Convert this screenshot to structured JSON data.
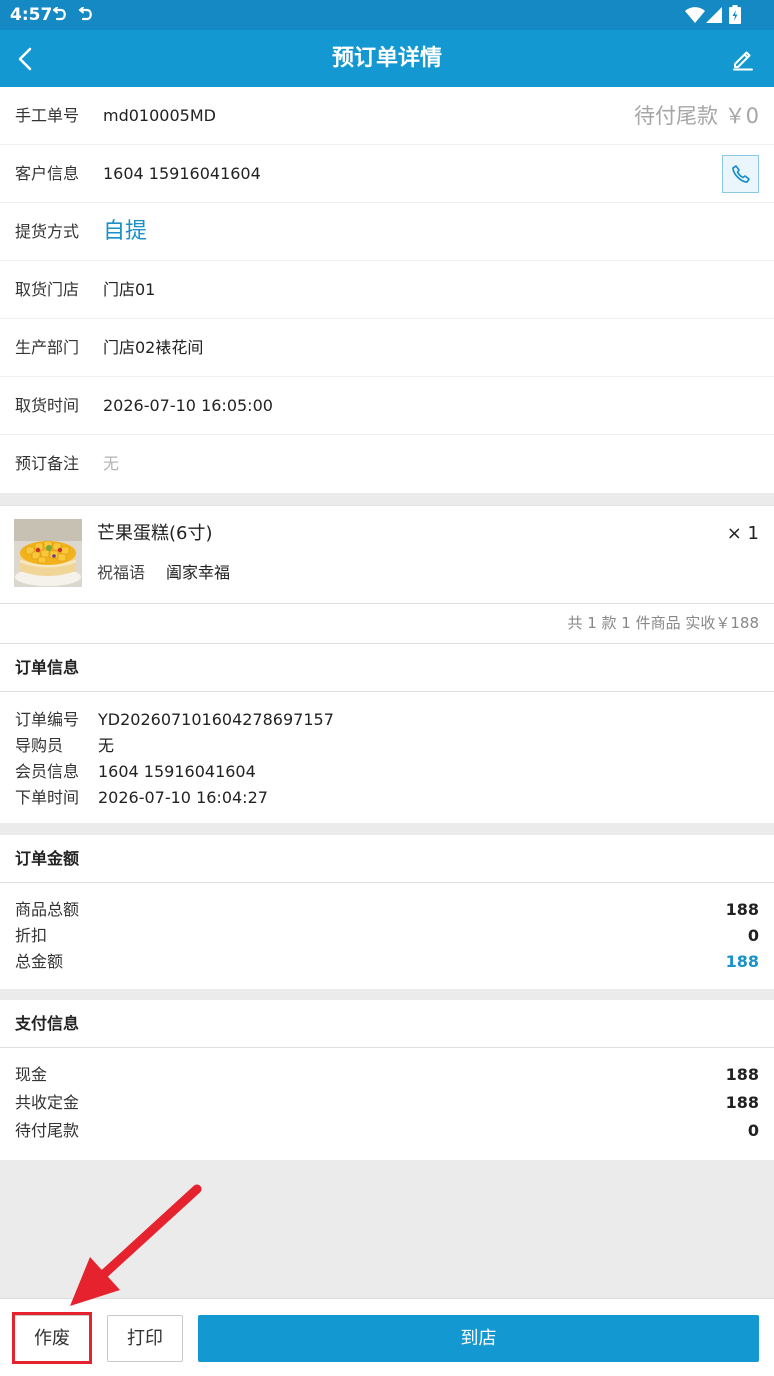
{
  "status_bar": {
    "time": "4:57",
    "icons": [
      "notification-icon",
      "notification-icon",
      "wifi-icon",
      "signal-icon",
      "battery-icon"
    ]
  },
  "header": {
    "title": "预订单详情",
    "left_icon": "back-arrow-icon",
    "right_icon": "edit-icon"
  },
  "details": [
    {
      "label": "手工单号",
      "value": "md010005MD",
      "extra": "待付尾款 ￥0"
    },
    {
      "label": "客户信息",
      "value": "1604 15916041604",
      "action_icon": "phone-icon"
    },
    {
      "label": "提货方式",
      "value": "自提"
    },
    {
      "label": "取货门店",
      "value": "门店01"
    },
    {
      "label": "生产部门",
      "value": "门店02裱花间"
    },
    {
      "label": "取货时间",
      "value": "2026-07-10 16:05:00"
    },
    {
      "label": "预订备注",
      "value": "无"
    }
  ],
  "product": {
    "name": "芒果蛋糕(6寸)",
    "blessing_label": "祝福语",
    "blessing": "阖家幸福",
    "quantity": "× 1"
  },
  "summary": "共 1 款 1 件商品 实收￥188",
  "order_info": {
    "title": "订单信息",
    "rows": [
      {
        "label": "订单编号",
        "value": "YD202607101604278697157"
      },
      {
        "label": "导购员",
        "value": "无"
      },
      {
        "label": "会员信息",
        "value": "1604 15916041604"
      },
      {
        "label": "下单时间",
        "value": "2026-07-10 16:04:27"
      }
    ]
  },
  "order_amount": {
    "title": "订单金额",
    "rows": [
      {
        "label": "商品总额",
        "value": "188"
      },
      {
        "label": "折扣",
        "value": "0"
      },
      {
        "label": "总金额",
        "value": "188",
        "highlight": true
      }
    ]
  },
  "payment_info": {
    "title": "支付信息",
    "rows": [
      {
        "label": "现金",
        "value": "188"
      },
      {
        "label": "共收定金",
        "value": "188"
      },
      {
        "label": "待付尾款",
        "value": "0"
      }
    ]
  },
  "actions": {
    "void": "作废",
    "print": "打印",
    "arrive": "到店"
  },
  "colors": {
    "accent": "#1398d1",
    "status_bar": "#1589c3",
    "annotation": "#e5222d",
    "muted": "#a6a6a6"
  }
}
